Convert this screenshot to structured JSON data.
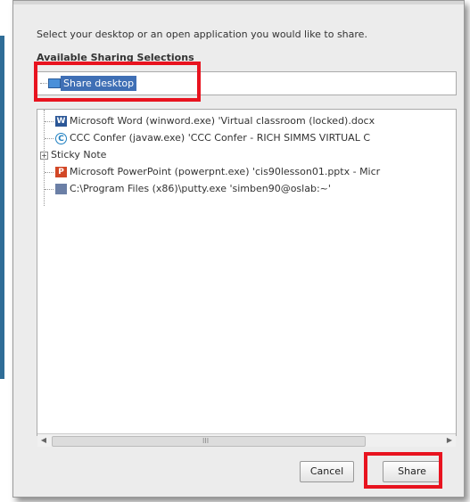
{
  "dialog": {
    "instruction": "Select your desktop or an open application you would like to share.",
    "section_title": "Available Sharing Selections",
    "desktop_item": "Share desktop",
    "apps": [
      {
        "icon": "word-icon",
        "label": "Microsoft Word (winword.exe) 'Virtual classroom (locked).docx"
      },
      {
        "icon": "ccc-confer-icon",
        "label": "CCC Confer (javaw.exe) 'CCC Confer - RICH SIMMS VIRTUAL C"
      },
      {
        "icon": "none",
        "label": "Sticky Note"
      },
      {
        "icon": "powerpoint-icon",
        "label": "Microsoft PowerPoint (powerpnt.exe) 'cis90lesson01.pptx - Micr"
      },
      {
        "icon": "putty-icon",
        "label": "C:\\Program Files (x86)\\putty.exe 'simben90@oslab:~'"
      }
    ],
    "cancel_label": "Cancel",
    "share_label": "Share",
    "scroll_grip": "III",
    "icon_glyphs": {
      "word": "W",
      "ccc": "C",
      "ppt": "P",
      "plus": "+",
      "left_arrow": "◀",
      "right_arrow": "▶"
    }
  },
  "colors": {
    "selection": "#3f6fb5",
    "highlight": "#e8131f",
    "left_bar": "#2f6d97"
  }
}
